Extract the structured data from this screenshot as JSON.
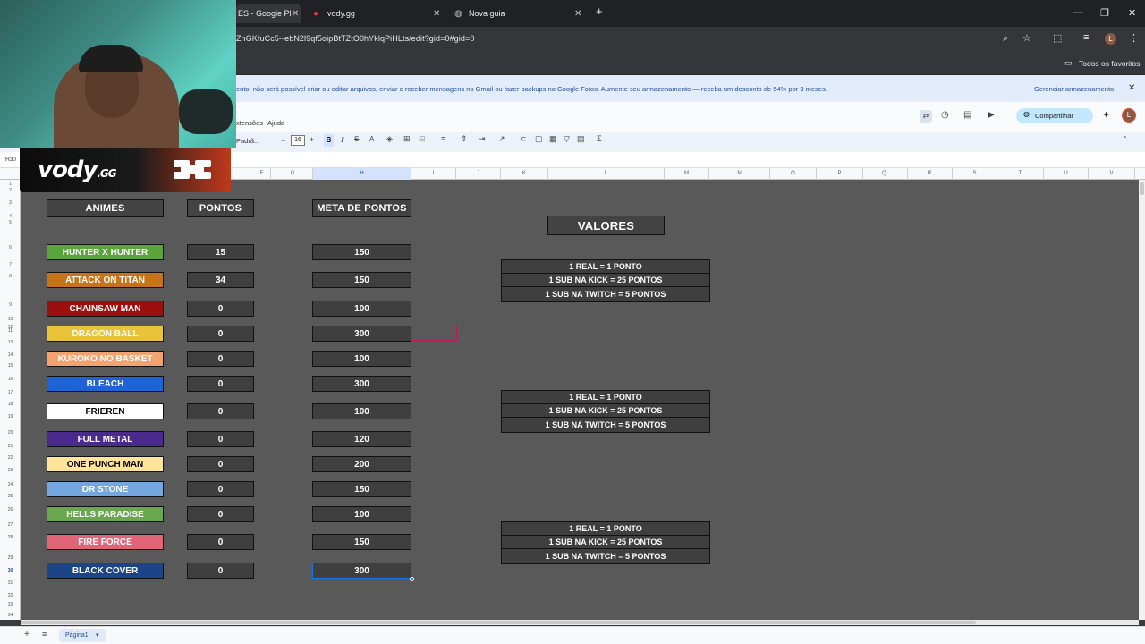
{
  "browser": {
    "tabs": [
      {
        "label": "ES - Google Pl"
      },
      {
        "label": "vody.gg"
      },
      {
        "label": "Nova guia"
      }
    ],
    "url": "ZnGKfuCc5--ebN2l9qf5oipBtTZtO0hYklqPiHLts/edit?gid=0#gid=0",
    "bookmarks_label": "Todos os favoritos",
    "profile_initial": "L"
  },
  "banner": {
    "text": "ento, não será possível criar ou editar arquivos, enviar e receber mensagens no Gmail ou fazer backups no Google Fotos. Aumente seu armazenamento — receba um desconto de 54% por 3 meses.",
    "action": "Gerenciar armazenamento"
  },
  "sheets": {
    "menu": [
      "xtensões",
      "Ajuda"
    ],
    "share_label": "Compartilhar",
    "font_name": "Padrã...",
    "font_size": "16",
    "cell_ref": "H30",
    "sheet_tab": "Página1"
  },
  "overlay": {
    "brand": "vody",
    "brand_suffix": ".GG"
  },
  "columns": [
    "F",
    "G",
    "H",
    "I",
    "J",
    "K",
    "L",
    "M",
    "N",
    "O",
    "P",
    "Q",
    "R",
    "S",
    "T",
    "U",
    "V"
  ],
  "rows": [
    "1",
    "2",
    "3",
    "4",
    "5",
    "6",
    "7",
    "8",
    "9",
    "10",
    "11",
    "12",
    "13",
    "14",
    "15",
    "16",
    "17",
    "18",
    "19",
    "20",
    "21",
    "22",
    "23",
    "24",
    "25",
    "26",
    "27",
    "28",
    "29",
    "30",
    "31",
    "32",
    "33",
    "34"
  ],
  "headers": {
    "animes": "ANIMES",
    "pontos": "PONTOS",
    "meta": "META DE PONTOS",
    "valores": "VALORES"
  },
  "animes": [
    {
      "name": "HUNTER X HUNTER",
      "pontos": "15",
      "meta": "150",
      "bg": "#5ba33b",
      "fg": "#ffffff"
    },
    {
      "name": "ATTACK ON TITAN",
      "pontos": "34",
      "meta": "150",
      "bg": "#c7731a",
      "fg": "#ffffff"
    },
    {
      "name": "CHAINSAW MAN",
      "pontos": "0",
      "meta": "100",
      "bg": "#9c0f0f",
      "fg": "#ffffff"
    },
    {
      "name": "DRAGON BALL",
      "pontos": "0",
      "meta": "300",
      "bg": "#e9c43a",
      "fg": "#ffffff"
    },
    {
      "name": "KUROKO NO BASKET",
      "pontos": "0",
      "meta": "100",
      "bg": "#f2a36f",
      "fg": "#ffffff"
    },
    {
      "name": "BLEACH",
      "pontos": "0",
      "meta": "300",
      "bg": "#1f64d6",
      "fg": "#ffffff"
    },
    {
      "name": "FRIEREN",
      "pontos": "0",
      "meta": "100",
      "bg": "#ffffff",
      "fg": "#000000"
    },
    {
      "name": "FULL METAL",
      "pontos": "0",
      "meta": "120",
      "bg": "#4a2a8c",
      "fg": "#ffffff"
    },
    {
      "name": "ONE PUNCH MAN",
      "pontos": "0",
      "meta": "200",
      "bg": "#ffe49a",
      "fg": "#000000"
    },
    {
      "name": "DR STONE",
      "pontos": "0",
      "meta": "150",
      "bg": "#74a7df",
      "fg": "#ffffff"
    },
    {
      "name": "HELLS PARADISE",
      "pontos": "0",
      "meta": "100",
      "bg": "#6aa84f",
      "fg": "#ffffff"
    },
    {
      "name": "FIRE FORCE",
      "pontos": "0",
      "meta": "150",
      "bg": "#e06677",
      "fg": "#ffffff"
    },
    {
      "name": "BLACK COVER",
      "pontos": "0",
      "meta": "300",
      "bg": "#1c4587",
      "fg": "#ffffff"
    }
  ],
  "valores": [
    [
      "1 REAL = 1 PONTO",
      "1 SUB NA KICK = 25 PONTOS",
      "1 SUB NA TWITCH = 5 PONTOS"
    ],
    [
      "1 REAL = 1 PONTO",
      "1 SUB NA KICK = 25 PONTOS",
      "1 SUB NA TWITCH = 5 PONTOS"
    ],
    [
      "1 REAL = 1 PONTO",
      "1 SUB NA KICK = 25 PONTOS",
      "1 SUB NA TWITCH = 5 PONTOS"
    ]
  ]
}
